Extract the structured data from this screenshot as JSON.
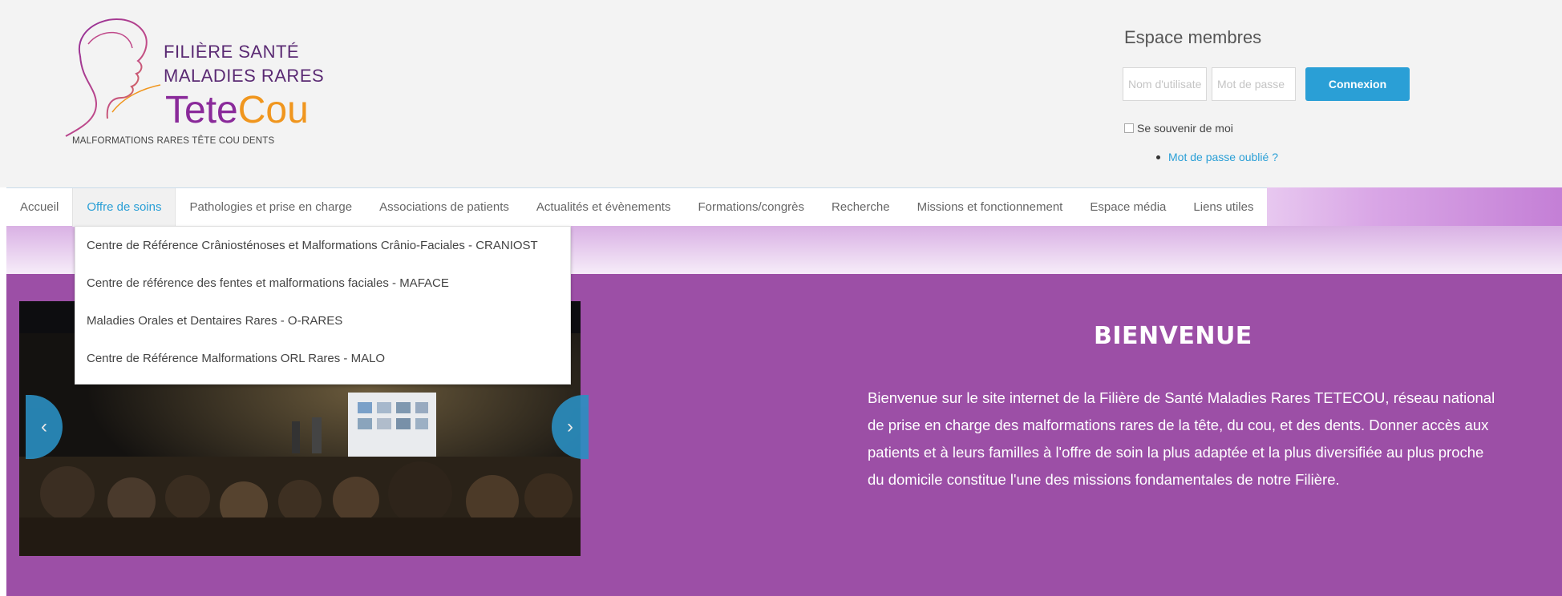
{
  "logo": {
    "line1": "FILIÈRE SANTÉ",
    "line2": "MALADIES RARES",
    "brand_part1": "Tete",
    "brand_part2": "Cou",
    "tagline": "MALFORMATIONS RARES TÊTE COU DENTS"
  },
  "members": {
    "title": "Espace membres",
    "username_placeholder": "Nom d'utilisateur",
    "password_placeholder": "Mot de passe",
    "login_button": "Connexion",
    "remember_label": "Se souvenir de moi",
    "forgot_link": "Mot de passe oublié ?"
  },
  "nav": {
    "items": [
      {
        "label": "Accueil"
      },
      {
        "label": "Offre de soins"
      },
      {
        "label": "Pathologies et prise en charge"
      },
      {
        "label": "Associations de patients"
      },
      {
        "label": "Actualités et évènements"
      },
      {
        "label": "Formations/congrès"
      },
      {
        "label": "Recherche"
      },
      {
        "label": "Missions et fonctionnement"
      },
      {
        "label": "Espace média"
      },
      {
        "label": "Liens utiles"
      }
    ],
    "active_index": 1
  },
  "dropdown": {
    "items": [
      {
        "label": "Centre de Référence Crâniosténoses et Malformations Crânio-Faciales - CRANIOST"
      },
      {
        "label": "Centre de référence des fentes et malformations faciales - MAFACE"
      },
      {
        "label": "Maladies Orales et Dentaires Rares - O-RARES"
      },
      {
        "label": "Centre de Référence Malformations ORL Rares - MALO"
      }
    ]
  },
  "carousel": {
    "prev_icon": "chevron-left-icon",
    "next_icon": "chevron-right-icon",
    "prev_glyph": "‹",
    "next_glyph": "›"
  },
  "welcome": {
    "title": "BIENVENUE",
    "text": "Bienvenue sur le site internet de la Filière de Santé Maladies Rares TETECOU, réseau national de prise en charge des malformations rares de la tête, du cou, et des dents. Donner accès aux patients et à leurs familles à l'offre de soin la plus adaptée et la plus diversifiée au plus proche du domicile constitue l'une des missions fondamentales de notre Filière."
  },
  "colors": {
    "brand_purple": "#9c4fa6",
    "accent_blue": "#2a9fd6",
    "logo_purple": "#8a2a9a",
    "logo_orange": "#f0961e"
  }
}
